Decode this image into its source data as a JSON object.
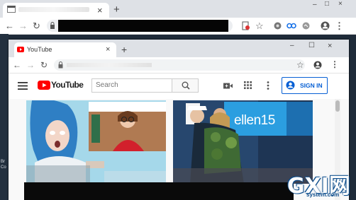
{
  "outer_browser": {
    "tab_close": "×",
    "new_tab": "+",
    "window_controls": [
      "–",
      "□",
      "×"
    ]
  },
  "inner_browser": {
    "tab_title": "YouTube",
    "tab_close": "×",
    "new_tab": "+",
    "window_controls": [
      "–",
      "☐",
      "×"
    ]
  },
  "youtube": {
    "logo_text": "YouTube",
    "search_placeholder": "Search",
    "signin_label": "SIGN IN"
  },
  "thumbnails": [
    {
      "overlay_text": ""
    },
    {
      "overlay_text": "ellen15"
    }
  ],
  "side_text": [
    "Br",
    "Co"
  ],
  "watermark": {
    "main": "GXI网",
    "sub": "system.com"
  },
  "colors": {
    "yt_red": "#ff0000",
    "signin_blue": "#065fd4",
    "chrome_tabbar": "#dee1e6"
  }
}
